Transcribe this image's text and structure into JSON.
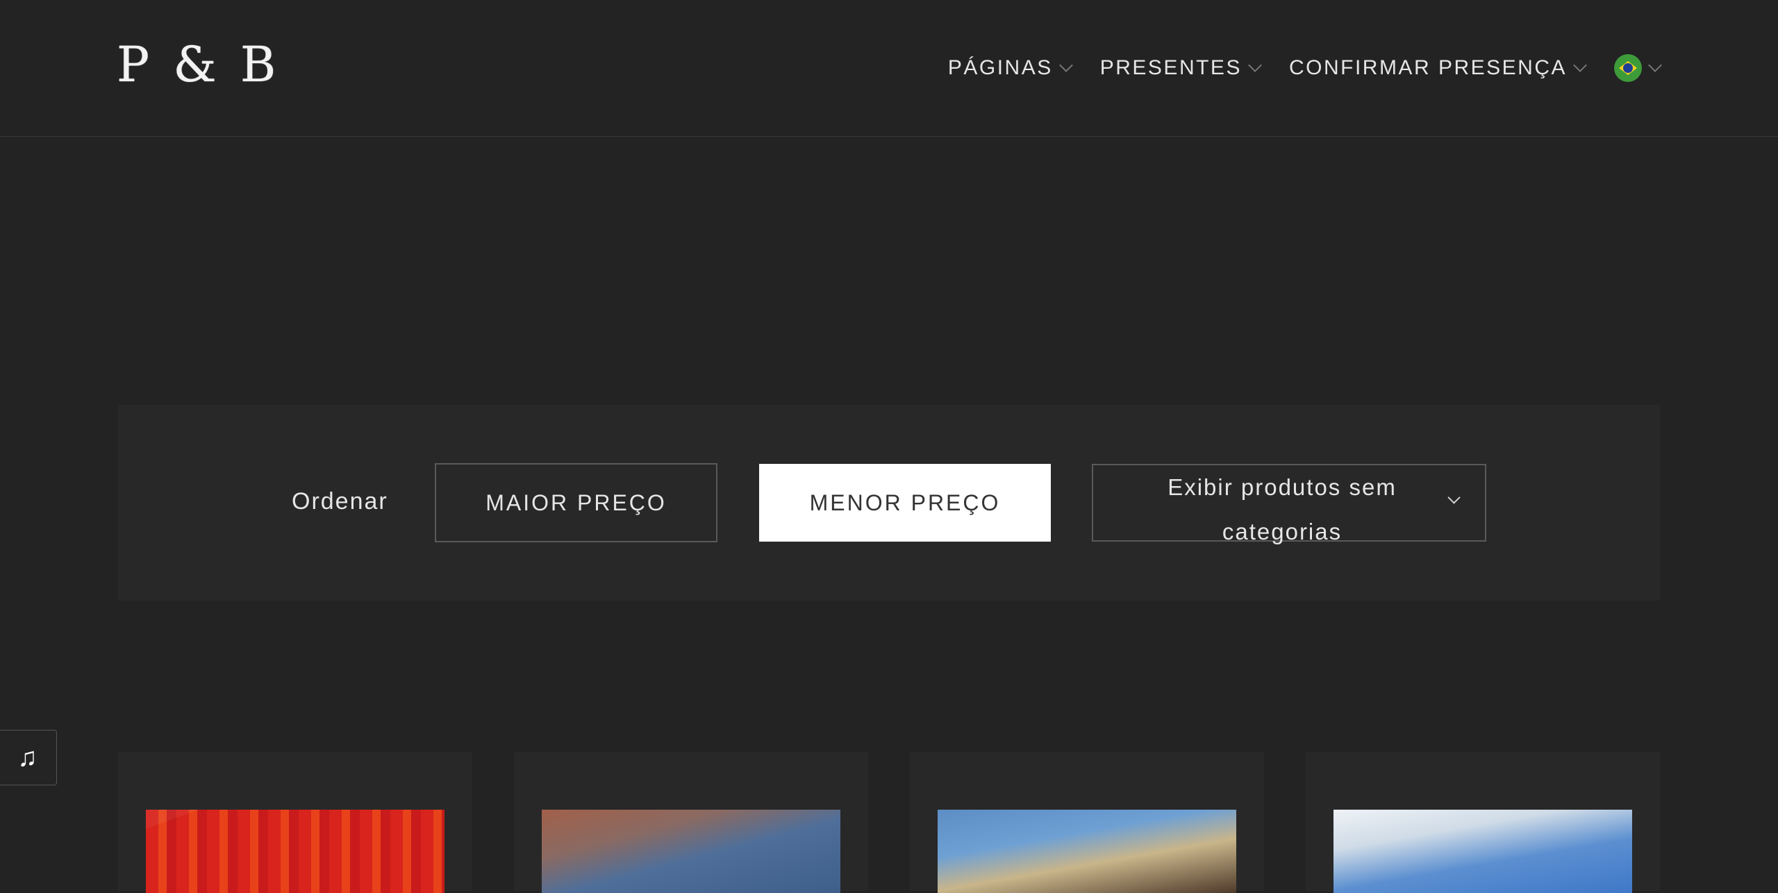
{
  "header": {
    "logo": "P & B",
    "nav": [
      {
        "label": "PÁGINAS"
      },
      {
        "label": "PRESENTES"
      },
      {
        "label": "CONFIRMAR PRESENÇA"
      }
    ],
    "language_icon": "brazil-flag-icon"
  },
  "sort": {
    "label": "Ordenar",
    "highest_price": "MAIOR PREÇO",
    "lowest_price": "MENOR PREÇO",
    "category_select": "Exibir produtos sem categorias"
  },
  "music_button": {
    "icon": "music-note-icon",
    "glyph": "♫"
  },
  "colors": {
    "background": "#232323",
    "panel": "#282828",
    "active_button": "#ffffff",
    "text": "#e6e6e6"
  }
}
